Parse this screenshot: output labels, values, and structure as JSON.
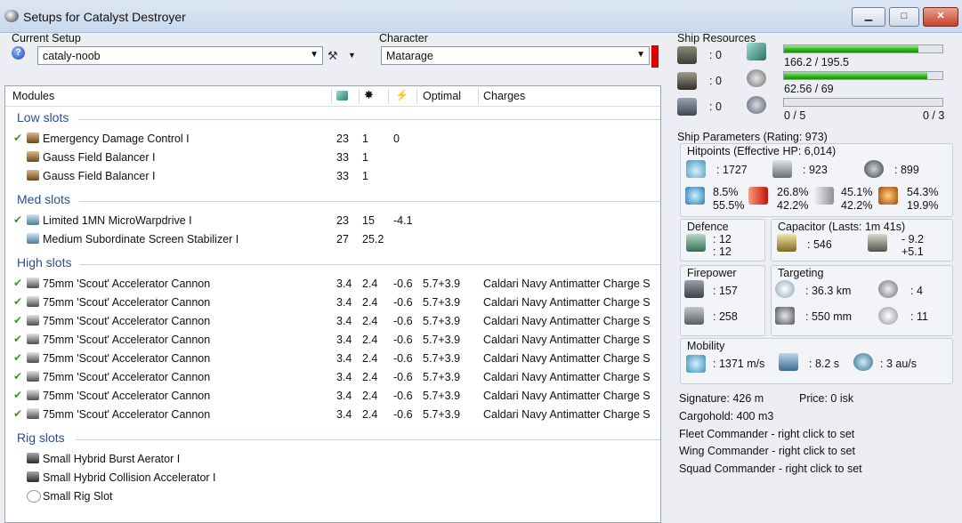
{
  "window": {
    "title": "Setups for Catalyst Destroyer",
    "minimize": "▁",
    "maximize": "□",
    "close": "✕"
  },
  "setup": {
    "label": "Current Setup",
    "value": "cataly-noob"
  },
  "character": {
    "label": "Character",
    "value": "Matarage"
  },
  "modules": {
    "headers": {
      "name": "Modules",
      "optimal": "Optimal",
      "charges": "Charges"
    },
    "sections": {
      "low": "Low slots",
      "med": "Med slots",
      "high": "High slots",
      "rig": "Rig slots"
    },
    "low": [
      {
        "name": "Emergency Damage Control I",
        "cpu": "23",
        "pg": "1",
        "cap": "0",
        "optimal": "",
        "charges": "",
        "online": "✔"
      },
      {
        "name": "Gauss Field Balancer I",
        "cpu": "33",
        "pg": "1",
        "cap": "",
        "optimal": "",
        "charges": "",
        "online": ""
      },
      {
        "name": "Gauss Field Balancer I",
        "cpu": "33",
        "pg": "1",
        "cap": "",
        "optimal": "",
        "charges": "",
        "online": ""
      }
    ],
    "med": [
      {
        "name": "Limited 1MN MicroWarpdrive I",
        "cpu": "23",
        "pg": "15",
        "cap": "-4.1",
        "optimal": "",
        "charges": "",
        "online": "✔"
      },
      {
        "name": "Medium Subordinate Screen Stabilizer I",
        "cpu": "27",
        "pg": "25.2",
        "cap": "",
        "optimal": "",
        "charges": "",
        "online": ""
      }
    ],
    "high": [
      {
        "name": "75mm 'Scout' Accelerator Cannon",
        "cpu": "3.4",
        "pg": "2.4",
        "cap": "-0.6",
        "optimal": "5.7+3.9",
        "charges": "Caldari Navy Antimatter Charge S",
        "online": "✔"
      },
      {
        "name": "75mm 'Scout' Accelerator Cannon",
        "cpu": "3.4",
        "pg": "2.4",
        "cap": "-0.6",
        "optimal": "5.7+3.9",
        "charges": "Caldari Navy Antimatter Charge S",
        "online": "✔"
      },
      {
        "name": "75mm 'Scout' Accelerator Cannon",
        "cpu": "3.4",
        "pg": "2.4",
        "cap": "-0.6",
        "optimal": "5.7+3.9",
        "charges": "Caldari Navy Antimatter Charge S",
        "online": "✔"
      },
      {
        "name": "75mm 'Scout' Accelerator Cannon",
        "cpu": "3.4",
        "pg": "2.4",
        "cap": "-0.6",
        "optimal": "5.7+3.9",
        "charges": "Caldari Navy Antimatter Charge S",
        "online": "✔"
      },
      {
        "name": "75mm 'Scout' Accelerator Cannon",
        "cpu": "3.4",
        "pg": "2.4",
        "cap": "-0.6",
        "optimal": "5.7+3.9",
        "charges": "Caldari Navy Antimatter Charge S",
        "online": "✔"
      },
      {
        "name": "75mm 'Scout' Accelerator Cannon",
        "cpu": "3.4",
        "pg": "2.4",
        "cap": "-0.6",
        "optimal": "5.7+3.9",
        "charges": "Caldari Navy Antimatter Charge S",
        "online": "✔"
      },
      {
        "name": "75mm 'Scout' Accelerator Cannon",
        "cpu": "3.4",
        "pg": "2.4",
        "cap": "-0.6",
        "optimal": "5.7+3.9",
        "charges": "Caldari Navy Antimatter Charge S",
        "online": "✔"
      },
      {
        "name": "75mm 'Scout' Accelerator Cannon",
        "cpu": "3.4",
        "pg": "2.4",
        "cap": "-0.6",
        "optimal": "5.7+3.9",
        "charges": "Caldari Navy Antimatter Charge S",
        "online": "✔"
      }
    ],
    "rig": [
      {
        "name": "Small Hybrid Burst Aerator I",
        "cpu": "",
        "pg": "",
        "cap": "",
        "optimal": "",
        "charges": "",
        "online": ""
      },
      {
        "name": "Small Hybrid Collision Accelerator I",
        "cpu": "",
        "pg": "",
        "cap": "",
        "optimal": "",
        "charges": "",
        "online": ""
      },
      {
        "name": "Small Rig Slot",
        "cpu": "",
        "pg": "",
        "cap": "",
        "optimal": "",
        "charges": "",
        "online": ""
      }
    ]
  },
  "resources": {
    "title": "Ship Resources",
    "turrets": ": 0",
    "launchers": ": 0",
    "drones": ": 0",
    "cpu_text": "166.2 / 195.5",
    "cpu_fraction": 0.85,
    "pg_text": "62.56 / 69",
    "pg_fraction": 0.907,
    "calib_text": "0 / 5",
    "rig_text": "0 / 3",
    "calib_fraction": 0
  },
  "params": {
    "title": "Ship Parameters (Rating: 973)",
    "hitpoints_title": "Hitpoints (Effective HP: 6,014)",
    "shield_hp": ": 1727",
    "armor_hp": ": 923",
    "structure_hp": ": 899",
    "em_a": "8.5%",
    "em_b": "55.5%",
    "therm_a": "26.8%",
    "therm_b": "42.2%",
    "kin_a": "45.1%",
    "kin_b": "42.2%",
    "exp_a": "54.3%",
    "exp_b": "19.9%",
    "defence_title": "Defence",
    "defence_a": ": 12",
    "defence_b": ": 12",
    "capacitor_title": "Capacitor (Lasts: 1m 41s)",
    "cap_amount": ": 546",
    "cap_a": "- 9.2",
    "cap_b": "+5.1",
    "firepower_title": "Firepower",
    "fp_a": ": 157",
    "fp_b": ": 258",
    "targeting_title": "Targeting",
    "range": ": 36.3 km",
    "targets": ": 4",
    "scanres": ": 550 mm",
    "sensor": ": 11",
    "mobility_title": "Mobility",
    "speed": ": 1371 m/s",
    "align": ": 8.2 s",
    "warp": ": 3 au/s"
  },
  "footer": {
    "signature": "Signature: 426 m",
    "price": "Price: 0 isk",
    "cargo": "Cargohold: 400 m3",
    "fleet": "Fleet Commander - right click to set",
    "wing": "Wing Commander - right click to set",
    "squad": "Squad Commander - right click to set"
  },
  "colors": {
    "section": "#2a4f90",
    "online_check": "#3a9a20",
    "bar_fill": "#2eb51a",
    "alert": "#e00000"
  }
}
